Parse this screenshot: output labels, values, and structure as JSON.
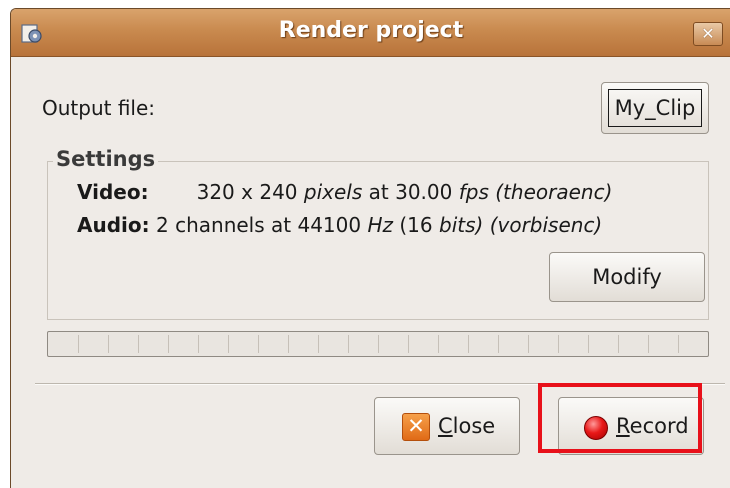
{
  "window": {
    "title": "Render project",
    "close_glyph": "✕",
    "icon": "app-gear-icon"
  },
  "output": {
    "label": "Output file:",
    "file_button": "My_Clip"
  },
  "settings": {
    "legend": "Settings",
    "video": {
      "label": "Video:",
      "width": "320",
      "times": "x",
      "height": "240",
      "unit_pixels": "pixels",
      "at": "at",
      "fps_value": "30.00",
      "unit_fps": "fps",
      "codec": "(theoraenc)"
    },
    "audio": {
      "label": "Audio:",
      "channels": "2",
      "channels_word": "channels",
      "at": "at",
      "rate": "44100",
      "unit_hz": "Hz",
      "bits_open": "(16",
      "unit_bits": "bits)",
      "codec": "(vorbisenc)"
    },
    "modify_button": "Modify"
  },
  "progress": {
    "value": 0,
    "segments": 22
  },
  "buttons": {
    "close": {
      "mnemonic": "C",
      "rest": "lose",
      "icon": "close-x-icon"
    },
    "record": {
      "mnemonic": "R",
      "rest": "ecord",
      "icon": "record-dot-icon"
    }
  },
  "colors": {
    "titlebar": "#c98a4f",
    "highlight": "#e8101a",
    "record_dot": "#e81818",
    "close_icon": "#e06a16"
  }
}
